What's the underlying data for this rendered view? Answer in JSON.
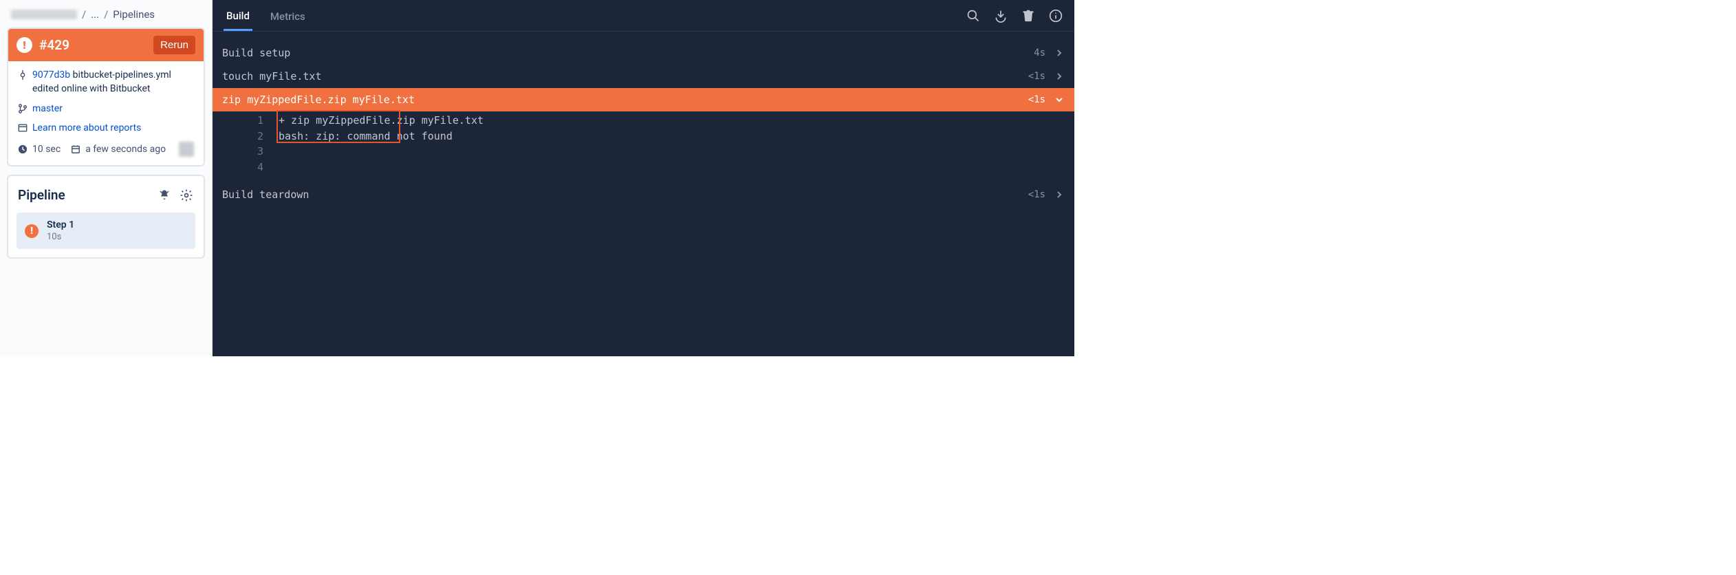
{
  "breadcrumb": {
    "sep": "/",
    "ellipsis": "...",
    "current": "Pipelines"
  },
  "run": {
    "number": "#429",
    "rerun_label": "Rerun",
    "commit_hash": "9077d3b",
    "commit_msg": "bitbucket-pipelines.yml edited online with Bitbucket",
    "branch": "master",
    "reports_link": "Learn more about reports",
    "duration": "10 sec",
    "relative_time": "a few seconds ago"
  },
  "pipeline": {
    "title": "Pipeline",
    "step_name": "Step 1",
    "step_duration": "10s"
  },
  "tabs": {
    "build": "Build",
    "metrics": "Metrics"
  },
  "log": {
    "rows": [
      {
        "cmd": "Build setup",
        "dur": "4s",
        "status": "ok",
        "expanded": false
      },
      {
        "cmd": "touch myFile.txt",
        "dur": "<1s",
        "status": "ok",
        "expanded": false
      },
      {
        "cmd": "zip myZippedFile.zip myFile.txt",
        "dur": "<1s",
        "status": "failed",
        "expanded": true
      },
      {
        "cmd": "Build teardown",
        "dur": "<1s",
        "status": "ok",
        "expanded": false
      }
    ],
    "output": [
      "+ zip myZippedFile.zip myFile.txt",
      "bash: zip: command not found",
      "",
      ""
    ]
  },
  "colors": {
    "orange": "#F0703F",
    "dark_bg": "#1D2538",
    "link": "#0052CC"
  }
}
